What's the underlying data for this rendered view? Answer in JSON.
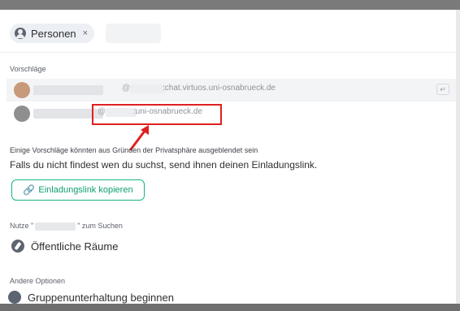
{
  "filter": {
    "chip_label": "Personen",
    "chip_close": "×"
  },
  "suggestions": {
    "title": "Vorschläge",
    "items": [
      {
        "at": "@",
        "domain": ":chat.virtuos.uni-osnabrueck.de"
      },
      {
        "at": "@",
        "domain": ":uni-osnabrueck.de"
      }
    ],
    "enter_glyph": "↵"
  },
  "privacy_note": "Einige Vorschläge könnten aus Gründen der Privatsphäre ausgeblendet sein",
  "help_text": "Falls du nicht findest wen du suchst, send ihnen deinen Einladungslink.",
  "invite_button": {
    "icon": "link-icon",
    "label": "Einladungslink kopieren"
  },
  "search_hint": {
    "prefix": "Nutze \"",
    "suffix": "\" zum Suchen"
  },
  "public_rooms": {
    "icon": "compass-icon",
    "label": "Öffentliche Räume"
  },
  "other_options": {
    "title": "Andere Optionen",
    "group_label": "Gruppenunterhaltung beginnen"
  },
  "colors": {
    "accent_green": "#0f9f6a",
    "highlight_red": "#e02020"
  }
}
